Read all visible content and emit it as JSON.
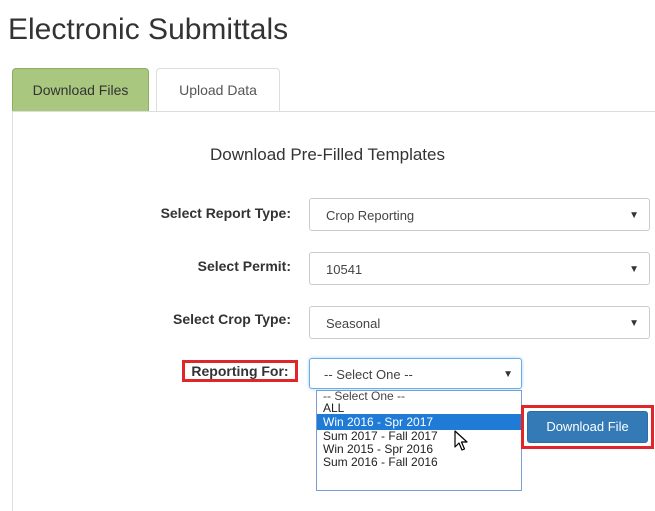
{
  "page": {
    "title": "Electronic Submittals"
  },
  "tabs": [
    {
      "label": "Download Files",
      "active": true
    },
    {
      "label": "Upload Data",
      "active": false
    }
  ],
  "main": {
    "subtitle": "Download Pre-Filled Templates",
    "fields": {
      "report_type": {
        "label": "Select Report Type:",
        "value": "Crop Reporting"
      },
      "permit": {
        "label": "Select Permit:",
        "value": "10541"
      },
      "crop_type": {
        "label": "Select Crop Type:",
        "value": "Seasonal"
      },
      "reporting_for": {
        "label": "Reporting For:",
        "value": "-- Select One --"
      }
    },
    "dropdown_options": [
      "-- Select One --",
      "ALL",
      "Win 2016 - Spr 2017",
      "Sum 2017 - Fall 2017",
      "Win 2015 - Spr 2016",
      "Sum 2016 - Fall 2016"
    ],
    "highlighted_option": "Win 2016 - Spr 2017",
    "download_button": "Download File"
  },
  "colors": {
    "active_tab": "#a9c77e",
    "primary_button": "#337ab7",
    "highlight_box": "#e0262a",
    "selected_option": "#1f7bd6"
  }
}
